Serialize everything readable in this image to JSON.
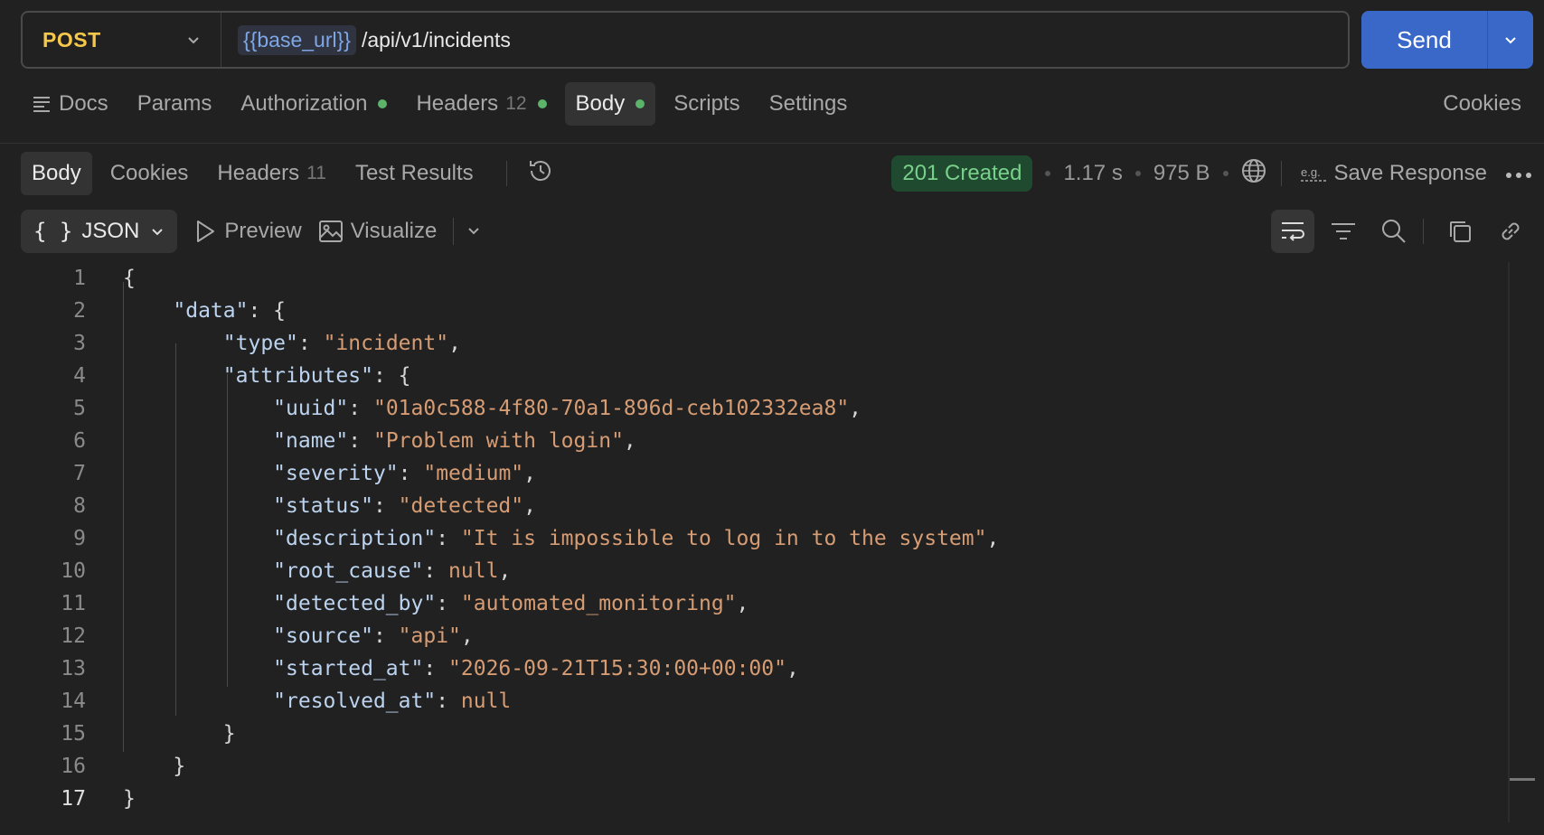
{
  "request": {
    "method": "POST",
    "url_variable": "{{base_url}}",
    "url_path": "/api/v1/incidents",
    "send_label": "Send"
  },
  "request_tabs": {
    "docs": "Docs",
    "params": "Params",
    "authorization": "Authorization",
    "headers": "Headers",
    "headers_count": "12",
    "body": "Body",
    "scripts": "Scripts",
    "settings": "Settings",
    "cookies": "Cookies"
  },
  "response_tabs": {
    "body": "Body",
    "cookies": "Cookies",
    "headers": "Headers",
    "headers_count": "11",
    "test_results": "Test Results"
  },
  "response_meta": {
    "status": "201 Created",
    "time": "1.17 s",
    "size": "975 B",
    "save_response": "Save Response"
  },
  "toolbar": {
    "format": "JSON",
    "preview": "Preview",
    "visualize": "Visualize"
  },
  "colors": {
    "method": "#f5c84b",
    "send_button": "#3a68c9",
    "status_bg": "#1f4a2f",
    "status_text": "#79d08b",
    "json_key": "#bcd3ef",
    "json_string": "#d69c74"
  },
  "code": {
    "active_line": 17,
    "lines": [
      {
        "num": "1",
        "text": "{"
      },
      {
        "num": "2",
        "text": "    \"data\": {"
      },
      {
        "num": "3",
        "text": "        \"type\": \"incident\","
      },
      {
        "num": "4",
        "text": "        \"attributes\": {"
      },
      {
        "num": "5",
        "text": "            \"uuid\": \"01a0c588-4f80-70a1-896d-ceb102332ea8\","
      },
      {
        "num": "6",
        "text": "            \"name\": \"Problem with login\","
      },
      {
        "num": "7",
        "text": "            \"severity\": \"medium\","
      },
      {
        "num": "8",
        "text": "            \"status\": \"detected\","
      },
      {
        "num": "9",
        "text": "            \"description\": \"It is impossible to log in to the system\","
      },
      {
        "num": "10",
        "text": "            \"root_cause\": null,"
      },
      {
        "num": "11",
        "text": "            \"detected_by\": \"automated_monitoring\","
      },
      {
        "num": "12",
        "text": "            \"source\": \"api\","
      },
      {
        "num": "13",
        "text": "            \"started_at\": \"2026-09-21T15:30:00+00:00\","
      },
      {
        "num": "14",
        "text": "            \"resolved_at\": null"
      },
      {
        "num": "15",
        "text": "        }"
      },
      {
        "num": "16",
        "text": "    }"
      },
      {
        "num": "17",
        "text": "}"
      }
    ]
  }
}
